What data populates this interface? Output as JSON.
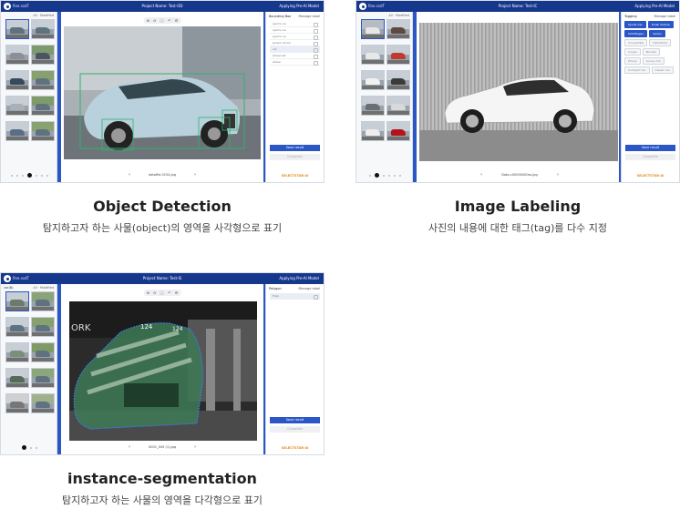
{
  "cards": [
    {
      "id": "od",
      "brand": "fine.ssdT",
      "project_name": "Project Name: Test-OD",
      "applying": "Applying Pre-AI Model",
      "left_header": "",
      "left_header_right": "All · Modified",
      "toolbar": [
        "⊕",
        "⊖",
        "⬜",
        "↶",
        "⚙"
      ],
      "file_name": "datafile-0154.jpg",
      "right_title": "Bounding Box",
      "right_title_right": "Manage label",
      "rows": [
        "sports car",
        "sports car",
        "sports car",
        "person-driver",
        "car",
        "wheel-set",
        "wheel"
      ],
      "save_label": "Save result",
      "complete_label": "Complete",
      "corp_mark": "SELECTSTAR·AI",
      "title": "Object Detection",
      "subtitle": "탐지하고자 하는 사물(object)의 영역을 사각형으로 표기"
    },
    {
      "id": "il",
      "brand": "fine.ssdT",
      "project_name": "Project Name: Test-IC",
      "applying": "Applying Pre-AI Model",
      "left_header": "",
      "left_header_right": "All · Modified",
      "file_name": "Data-c00000000ss.jpg",
      "right_title": "Tagging",
      "right_title_right": "Manage label",
      "tags": [
        "Sports Car",
        "Small Vehicle",
        "SUV/Wagon",
        "Sedan",
        "Convertible",
        "Hatchback",
        "Coupe",
        "Minivan",
        "Pickup",
        "Luxury Car",
        "Compact Car",
        "Classic Car"
      ],
      "tags_on": [
        0,
        1,
        2,
        3
      ],
      "save_label": "Save result",
      "complete_label": "Complete",
      "corp_mark": "SELECTSTAR·AI",
      "title": "Image Labeling",
      "subtitle": "사진의 내용에 대한 태그(tag)를 다수 지정"
    },
    {
      "id": "is",
      "brand": "fine.ssdT",
      "project_name": "Project Name: Test-IS",
      "applying": "Applying Pre-AI Model",
      "left_header": "car(8)",
      "left_header_right": "All · Modified",
      "toolbar": [
        "⊕",
        "⊖",
        "⬜",
        "↶",
        "⚙"
      ],
      "file_name": "0001_049 (1).jpg",
      "right_title": "Polygon",
      "right_title_right": "Manage label",
      "rows": [
        "Train"
      ],
      "save_label": "Save result",
      "complete_label": "Complete",
      "corp_mark": "SELECTSTAR·AI",
      "title": "instance-segmentation",
      "subtitle": "탐지하고자 하는 사물의 영역을 다각형으로 표기"
    }
  ],
  "colors": {
    "titlebar": "#16388c",
    "accent": "#2a56c6",
    "corp_orange": "#e58a1f"
  }
}
